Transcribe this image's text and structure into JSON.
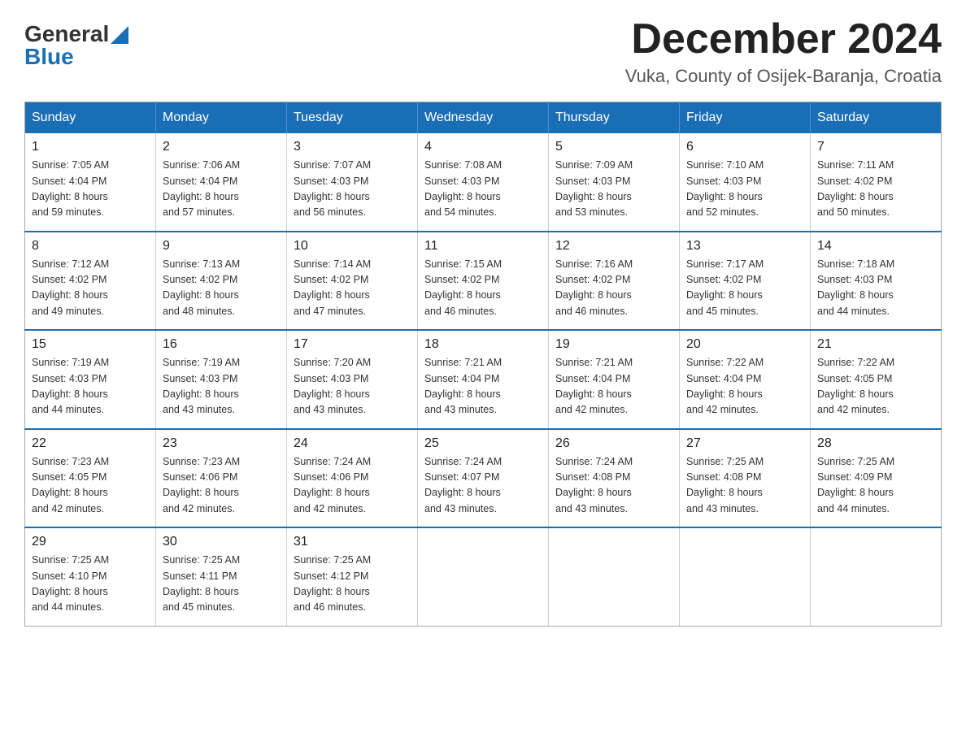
{
  "header": {
    "logo_general": "General",
    "logo_blue": "Blue",
    "month_title": "December 2024",
    "location": "Vuka, County of Osijek-Baranja, Croatia"
  },
  "weekdays": [
    "Sunday",
    "Monday",
    "Tuesday",
    "Wednesday",
    "Thursday",
    "Friday",
    "Saturday"
  ],
  "weeks": [
    [
      {
        "day": "1",
        "info": "Sunrise: 7:05 AM\nSunset: 4:04 PM\nDaylight: 8 hours\nand 59 minutes."
      },
      {
        "day": "2",
        "info": "Sunrise: 7:06 AM\nSunset: 4:04 PM\nDaylight: 8 hours\nand 57 minutes."
      },
      {
        "day": "3",
        "info": "Sunrise: 7:07 AM\nSunset: 4:03 PM\nDaylight: 8 hours\nand 56 minutes."
      },
      {
        "day": "4",
        "info": "Sunrise: 7:08 AM\nSunset: 4:03 PM\nDaylight: 8 hours\nand 54 minutes."
      },
      {
        "day": "5",
        "info": "Sunrise: 7:09 AM\nSunset: 4:03 PM\nDaylight: 8 hours\nand 53 minutes."
      },
      {
        "day": "6",
        "info": "Sunrise: 7:10 AM\nSunset: 4:03 PM\nDaylight: 8 hours\nand 52 minutes."
      },
      {
        "day": "7",
        "info": "Sunrise: 7:11 AM\nSunset: 4:02 PM\nDaylight: 8 hours\nand 50 minutes."
      }
    ],
    [
      {
        "day": "8",
        "info": "Sunrise: 7:12 AM\nSunset: 4:02 PM\nDaylight: 8 hours\nand 49 minutes."
      },
      {
        "day": "9",
        "info": "Sunrise: 7:13 AM\nSunset: 4:02 PM\nDaylight: 8 hours\nand 48 minutes."
      },
      {
        "day": "10",
        "info": "Sunrise: 7:14 AM\nSunset: 4:02 PM\nDaylight: 8 hours\nand 47 minutes."
      },
      {
        "day": "11",
        "info": "Sunrise: 7:15 AM\nSunset: 4:02 PM\nDaylight: 8 hours\nand 46 minutes."
      },
      {
        "day": "12",
        "info": "Sunrise: 7:16 AM\nSunset: 4:02 PM\nDaylight: 8 hours\nand 46 minutes."
      },
      {
        "day": "13",
        "info": "Sunrise: 7:17 AM\nSunset: 4:02 PM\nDaylight: 8 hours\nand 45 minutes."
      },
      {
        "day": "14",
        "info": "Sunrise: 7:18 AM\nSunset: 4:03 PM\nDaylight: 8 hours\nand 44 minutes."
      }
    ],
    [
      {
        "day": "15",
        "info": "Sunrise: 7:19 AM\nSunset: 4:03 PM\nDaylight: 8 hours\nand 44 minutes."
      },
      {
        "day": "16",
        "info": "Sunrise: 7:19 AM\nSunset: 4:03 PM\nDaylight: 8 hours\nand 43 minutes."
      },
      {
        "day": "17",
        "info": "Sunrise: 7:20 AM\nSunset: 4:03 PM\nDaylight: 8 hours\nand 43 minutes."
      },
      {
        "day": "18",
        "info": "Sunrise: 7:21 AM\nSunset: 4:04 PM\nDaylight: 8 hours\nand 43 minutes."
      },
      {
        "day": "19",
        "info": "Sunrise: 7:21 AM\nSunset: 4:04 PM\nDaylight: 8 hours\nand 42 minutes."
      },
      {
        "day": "20",
        "info": "Sunrise: 7:22 AM\nSunset: 4:04 PM\nDaylight: 8 hours\nand 42 minutes."
      },
      {
        "day": "21",
        "info": "Sunrise: 7:22 AM\nSunset: 4:05 PM\nDaylight: 8 hours\nand 42 minutes."
      }
    ],
    [
      {
        "day": "22",
        "info": "Sunrise: 7:23 AM\nSunset: 4:05 PM\nDaylight: 8 hours\nand 42 minutes."
      },
      {
        "day": "23",
        "info": "Sunrise: 7:23 AM\nSunset: 4:06 PM\nDaylight: 8 hours\nand 42 minutes."
      },
      {
        "day": "24",
        "info": "Sunrise: 7:24 AM\nSunset: 4:06 PM\nDaylight: 8 hours\nand 42 minutes."
      },
      {
        "day": "25",
        "info": "Sunrise: 7:24 AM\nSunset: 4:07 PM\nDaylight: 8 hours\nand 43 minutes."
      },
      {
        "day": "26",
        "info": "Sunrise: 7:24 AM\nSunset: 4:08 PM\nDaylight: 8 hours\nand 43 minutes."
      },
      {
        "day": "27",
        "info": "Sunrise: 7:25 AM\nSunset: 4:08 PM\nDaylight: 8 hours\nand 43 minutes."
      },
      {
        "day": "28",
        "info": "Sunrise: 7:25 AM\nSunset: 4:09 PM\nDaylight: 8 hours\nand 44 minutes."
      }
    ],
    [
      {
        "day": "29",
        "info": "Sunrise: 7:25 AM\nSunset: 4:10 PM\nDaylight: 8 hours\nand 44 minutes."
      },
      {
        "day": "30",
        "info": "Sunrise: 7:25 AM\nSunset: 4:11 PM\nDaylight: 8 hours\nand 45 minutes."
      },
      {
        "day": "31",
        "info": "Sunrise: 7:25 AM\nSunset: 4:12 PM\nDaylight: 8 hours\nand 46 minutes."
      },
      {
        "day": "",
        "info": ""
      },
      {
        "day": "",
        "info": ""
      },
      {
        "day": "",
        "info": ""
      },
      {
        "day": "",
        "info": ""
      }
    ]
  ]
}
